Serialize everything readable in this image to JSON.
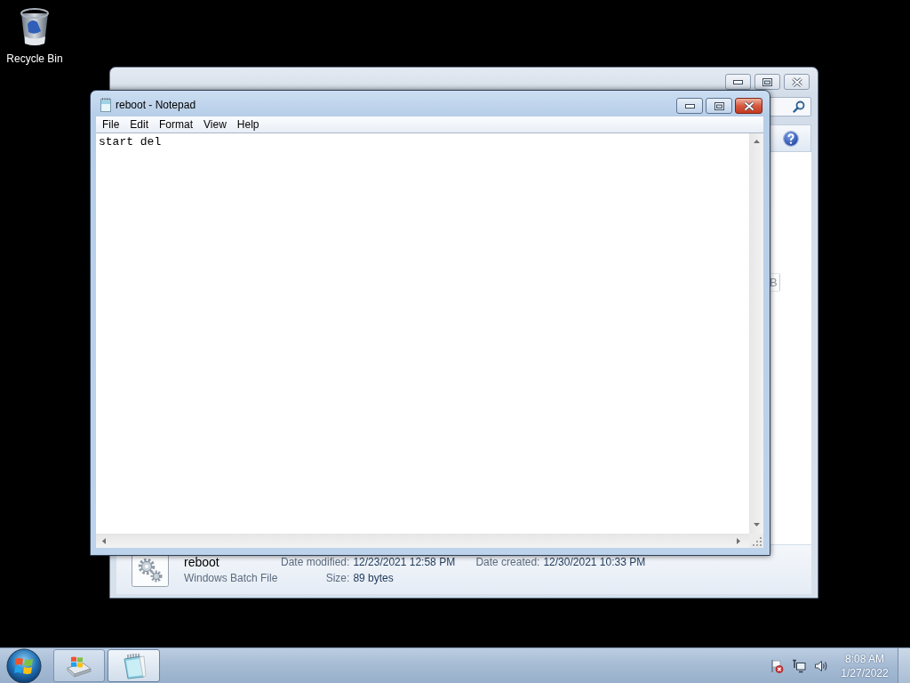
{
  "desktop": {
    "icons": [
      {
        "label": "Recycle Bin"
      }
    ]
  },
  "explorer_window": {
    "active": false,
    "file_list": {
      "visible_text": "B"
    },
    "details_pane": {
      "name": "reboot",
      "type": "Windows Batch File",
      "properties": [
        {
          "label": "Date modified:",
          "value": "12/23/2021 12:58 PM"
        },
        {
          "label": "Date created:",
          "value": "12/30/2021 10:33 PM"
        },
        {
          "label": "Size:",
          "value": "89 bytes"
        }
      ]
    }
  },
  "notepad_window": {
    "active": true,
    "title": "reboot - Notepad",
    "menu": [
      {
        "label": "File"
      },
      {
        "label": "Edit"
      },
      {
        "label": "Format"
      },
      {
        "label": "View"
      },
      {
        "label": "Help"
      }
    ],
    "text": "start del"
  },
  "taskbar": {
    "buttons": [
      {
        "kind": "explorer",
        "selected": false
      },
      {
        "kind": "notepad",
        "selected": true
      }
    ],
    "clock": {
      "time": "8:08 AM",
      "date": "1/27/2022"
    }
  }
}
